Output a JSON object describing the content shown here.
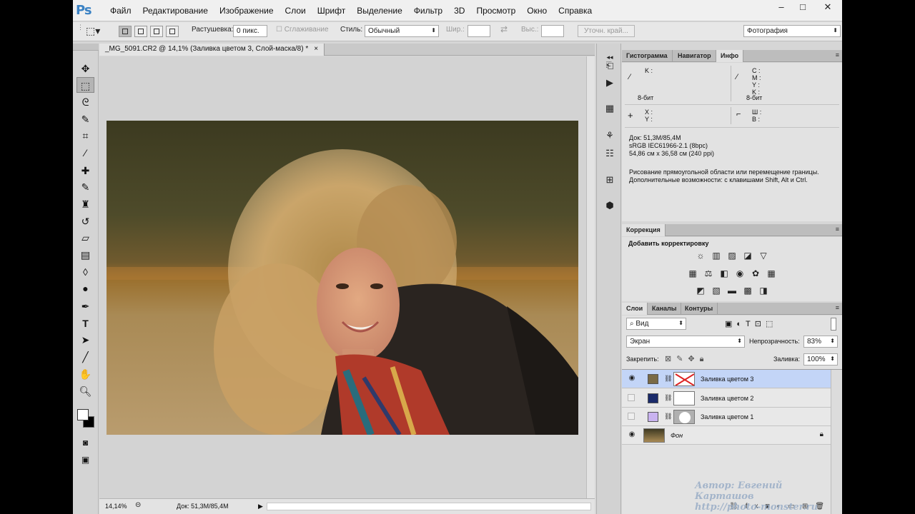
{
  "app": {
    "logo": "Ps"
  },
  "menu": [
    "Файл",
    "Редактирование",
    "Изображение",
    "Слои",
    "Шрифт",
    "Выделение",
    "Фильтр",
    "3D",
    "Просмотр",
    "Окно",
    "Справка"
  ],
  "window_controls": {
    "minimize": "–",
    "maximize": "□",
    "close": "✕"
  },
  "options_bar": {
    "feather_label": "Растушевка:",
    "feather_value": "0 пикс.",
    "antialias_label": "Сглаживание",
    "style_label": "Стиль:",
    "style_value": "Обычный",
    "width_label": "Шир.:",
    "height_label": "Выс.:",
    "refine_edge": "Уточн. край...",
    "workspace": "Фотография"
  },
  "document": {
    "tab_title": "_MG_5091.CR2 @ 14,1% (Заливка цветом 3, Слой-маска/8) *",
    "tab_close": "×"
  },
  "status_bar": {
    "zoom": "14,14%",
    "doc_size": "Док: 51,3M/85,4M"
  },
  "panels": {
    "info_tabs": [
      "Гистограмма",
      "Навигатор",
      "Инфо"
    ],
    "info": {
      "k_label": "K :",
      "bit_left": "8-бит",
      "cmyk": [
        "C :",
        "M :",
        "Y :",
        "K :"
      ],
      "bit_right": "8-бит",
      "xy": [
        "X :",
        "Y :"
      ],
      "wh": [
        "Ш :",
        "В :"
      ],
      "doc_line1": "Док: 51,3M/85,4M",
      "doc_line2": "sRGB IEC61966-2.1 (8bpc)",
      "doc_line3": "54,86 см x 36,58 см (240 ppi)",
      "hint_line1": "Рисование прямоугольной области или перемещение границы.",
      "hint_line2": "Дополнительные возможности: с клавишами Shift, Alt и Ctrl."
    },
    "correction_tab": "Коррекция",
    "correction_title": "Добавить корректировку",
    "layers_tabs": [
      "Слои",
      "Каналы",
      "Контуры"
    ],
    "layers": {
      "filter_kind": "Вид",
      "blend_mode": "Экран",
      "opacity_label": "Непрозрачность:",
      "opacity_value": "83%",
      "lock_label": "Закрепить:",
      "fill_label": "Заливка:",
      "fill_value": "100%",
      "items": [
        {
          "name": "Заливка цветом 3",
          "color": "#7a6a45",
          "visible": true,
          "selected": true
        },
        {
          "name": "Заливка цветом 2",
          "color": "#1a2a6a",
          "visible": false,
          "selected": false
        },
        {
          "name": "Заливка цветом 1",
          "color": "#c9b3f0",
          "visible": false,
          "selected": false
        },
        {
          "name": "Фон",
          "visible": true,
          "selected": false
        }
      ]
    }
  },
  "watermark": {
    "line1": "Автор: Евгений Карташов",
    "line2": "http://photo-monster.ru"
  }
}
